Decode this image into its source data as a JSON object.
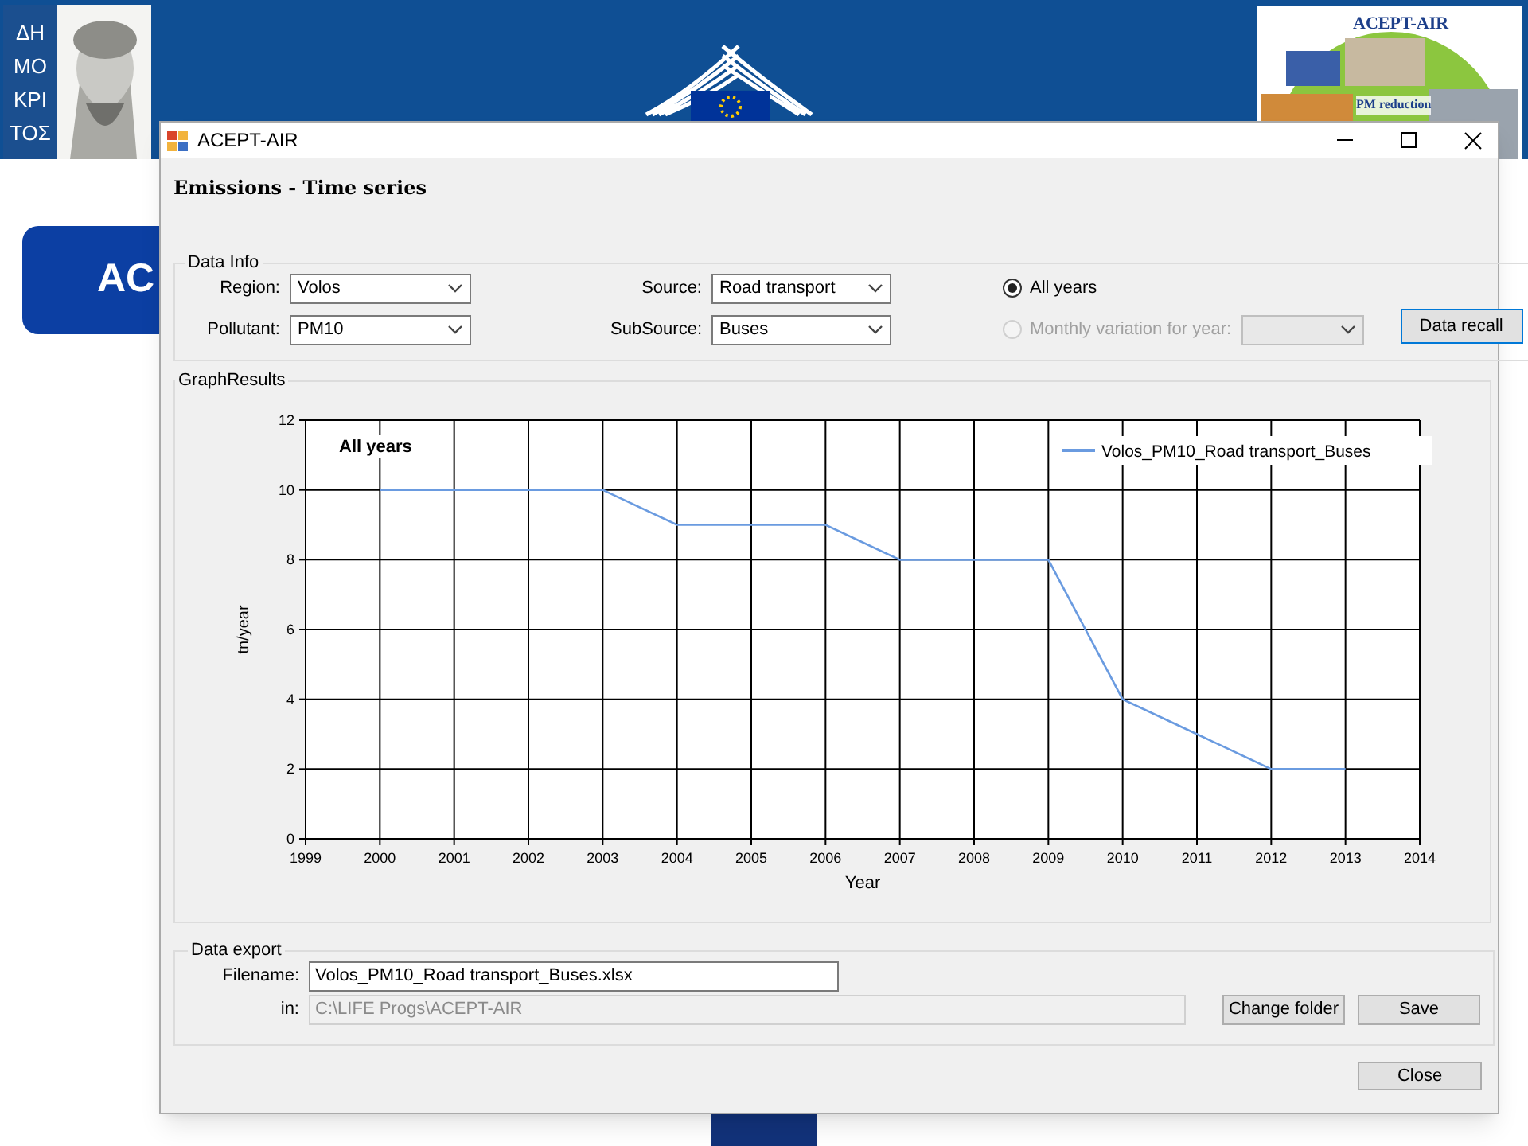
{
  "slide": {
    "left_logo_lines": [
      "ΔΗ",
      "ΜΟ",
      "ΚΡΙ",
      "ΤΟΣ"
    ],
    "right_logo": {
      "title": "ACEPT-AIR",
      "subtitle": "PM reduction"
    },
    "partial_banner": "AC"
  },
  "window": {
    "title": "ACEPT-AIR",
    "heading": "Emissions - Time series"
  },
  "data_info": {
    "legend": "Data Info",
    "fields": [
      {
        "label": "Region:",
        "value": "Volos"
      },
      {
        "label": "Source:",
        "value": "Road transport"
      },
      {
        "label": "Pollutant:",
        "value": "PM10"
      },
      {
        "label": "SubSource:",
        "value": "Buses"
      }
    ],
    "radios": [
      {
        "label": "All years",
        "selected": true,
        "disabled": false
      },
      {
        "label": "Monthly variation for year:",
        "selected": false,
        "disabled": true
      }
    ],
    "year_combo": {
      "disabled": true
    },
    "button": "Data recall"
  },
  "graph": {
    "legend": "GraphResults",
    "chart_data": {
      "type": "line",
      "title": "All years",
      "xlabel": "Year",
      "ylabel": "tn/year",
      "x": [
        2000,
        2001,
        2002,
        2003,
        2004,
        2005,
        2006,
        2007,
        2008,
        2009,
        2010,
        2011,
        2012,
        2013
      ],
      "series": [
        {
          "name": "Volos_PM10_Road transport_Buses",
          "color": "#6a9be0",
          "values": [
            10,
            10,
            10,
            10,
            9,
            9,
            9,
            8,
            8,
            8,
            4,
            3,
            2,
            2
          ]
        }
      ],
      "grid": true,
      "xlim": [
        1999,
        2014
      ],
      "ylim": [
        0,
        12
      ],
      "xticks": [
        1999,
        2000,
        2001,
        2002,
        2003,
        2004,
        2005,
        2006,
        2007,
        2008,
        2009,
        2010,
        2011,
        2012,
        2013,
        2014
      ],
      "yticks": [
        0,
        2,
        4,
        6,
        8,
        10,
        12
      ]
    }
  },
  "data_export": {
    "legend": "Data export",
    "filename_label": "Filename:",
    "filename": "Volos_PM10_Road transport_Buses.xlsx",
    "folder_label": "in:",
    "folder": "C:\\LIFE Progs\\ACEPT-AIR",
    "folder_disabled": true,
    "buttons": [
      "Change folder",
      "Save"
    ]
  },
  "close_button": "Close"
}
